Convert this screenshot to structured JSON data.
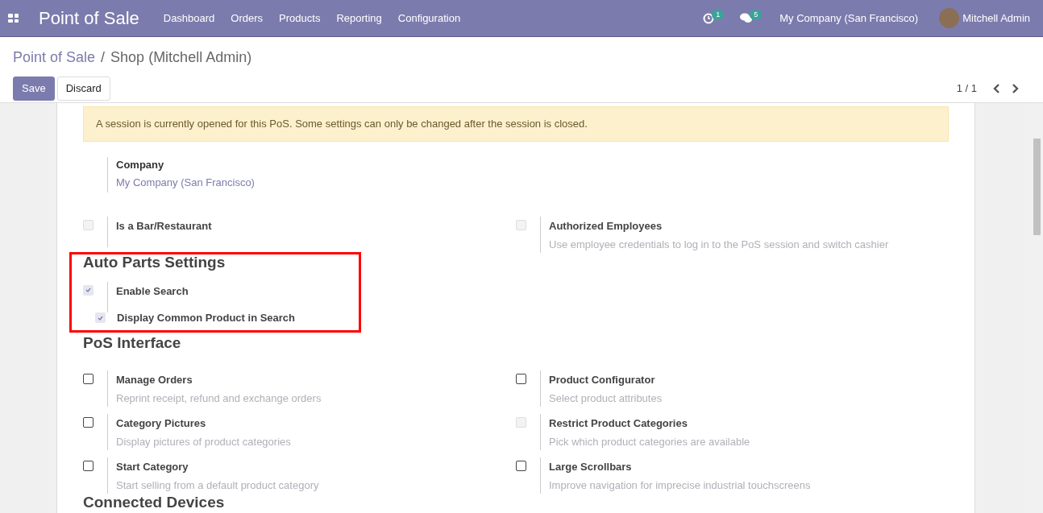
{
  "navbar": {
    "app_title": "Point of Sale",
    "menu": [
      "Dashboard",
      "Orders",
      "Products",
      "Reporting",
      "Configuration"
    ],
    "activity_count": "1",
    "message_count": "5",
    "company": "My Company (San Francisco)",
    "user": "Mitchell Admin"
  },
  "breadcrumb": {
    "parent": "Point of Sale",
    "separator": "/",
    "current": "Shop (Mitchell Admin)"
  },
  "buttons": [
    {
      "label": "Save",
      "kind": "primary"
    },
    {
      "label": "Discard",
      "kind": "secondary"
    }
  ],
  "pager": {
    "value": "1 / 1"
  },
  "alert": "A session is currently opened for this PoS. Some settings can only be changed after the session is closed.",
  "company": {
    "label": "Company",
    "value": "My Company (San Francisco)"
  },
  "sections": [
    {
      "items": [
        {
          "kind": "setting",
          "label": "Is a Bar/Restaurant",
          "checked": false,
          "disabled": true
        },
        {
          "kind": "setting",
          "label": "Authorized Employees",
          "description": "Use employee credentials to log in to the PoS session and switch cashier",
          "checked": false,
          "disabled": true
        }
      ]
    },
    {
      "title": "Auto Parts Settings",
      "highlighted": true,
      "items": [
        {
          "kind": "setting_wide",
          "label": "Enable Search",
          "checked": true,
          "disabled": true
        },
        {
          "kind": "inline",
          "label": "Display Common Product in Search",
          "checked": true,
          "disabled": true
        }
      ]
    },
    {
      "title": "PoS Interface",
      "items": [
        {
          "kind": "setting",
          "label": "Manage Orders",
          "description": "Reprint receipt, refund and exchange orders",
          "checked": false,
          "disabled": false
        },
        {
          "kind": "setting",
          "label": "Product Configurator",
          "description": "Select product attributes",
          "checked": false,
          "disabled": false
        },
        {
          "kind": "setting",
          "label": "Category Pictures",
          "description": "Display pictures of product categories",
          "checked": false,
          "disabled": false
        },
        {
          "kind": "setting",
          "label": "Restrict Product Categories",
          "description": "Pick which product categories are available",
          "checked": false,
          "disabled": true
        },
        {
          "kind": "setting",
          "label": "Start Category",
          "description": "Start selling from a default product category",
          "checked": false,
          "disabled": false
        },
        {
          "kind": "setting",
          "label": "Large Scrollbars",
          "description": "Improve navigation for imprecise industrial touchscreens",
          "checked": false,
          "disabled": false
        }
      ]
    },
    {
      "title": "Connected Devices"
    }
  ]
}
